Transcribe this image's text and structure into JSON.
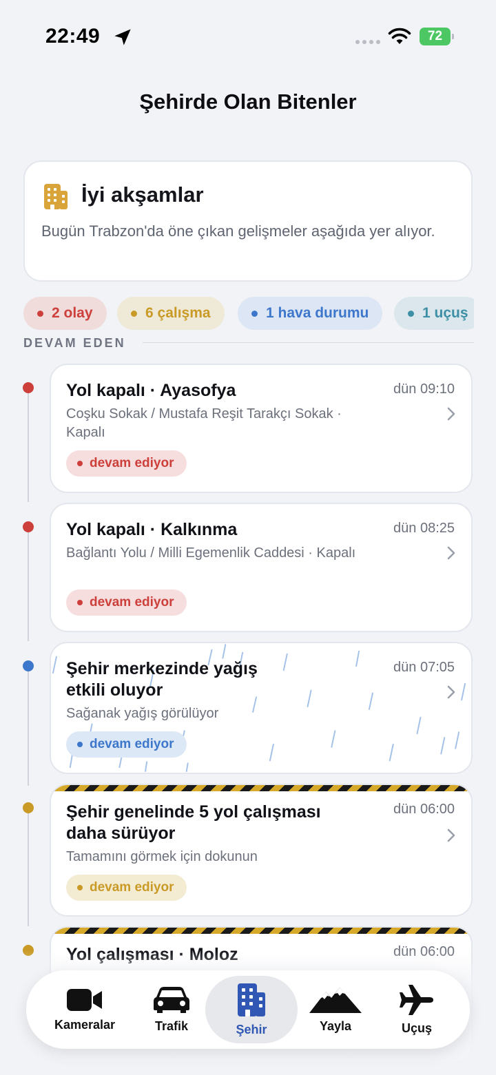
{
  "status_bar": {
    "time": "22:49",
    "battery": "72"
  },
  "page_title": "Şehirde Olan Bitenler",
  "greeting": {
    "title": "İyi akşamlar",
    "text": "Bugün Trabzon'da öne çıkan gelişmeler aşağıda yer alıyor."
  },
  "chips": [
    {
      "label": "2 olay",
      "color": "#cc3f3a"
    },
    {
      "label": "6 çalışma",
      "color": "#c99a26"
    },
    {
      "label": "1 hava durumu",
      "color": "#3d77cc"
    },
    {
      "label": "1 uçuş",
      "color": "#3c8fa5"
    }
  ],
  "section_label": "DEVAM EDEN",
  "events": [
    {
      "title": "Yol kapalı · Ayasofya",
      "time": "dün 09:10",
      "subtitle": "Coşku Sokak / Mustafa Reşit Tarakçı Sokak · Kapalı",
      "status": "devam ediyor",
      "color": "#cc3f3a"
    },
    {
      "title": "Yol kapalı · Kalkınma",
      "time": "dün 08:25",
      "subtitle": "Bağlantı Yolu / Milli Egemenlik Caddesi · Kapalı",
      "status": "devam ediyor",
      "color": "#cc3f3a"
    },
    {
      "title": "Şehir merkezinde yağış etkili oluyor",
      "time": "dün 07:05",
      "subtitle": "Sağanak yağış görülüyor",
      "status": "devam ediyor",
      "color": "#3d77cc"
    },
    {
      "title": "Şehir genelinde 5 yol çalışması daha sürüyor",
      "time": "dün 06:00",
      "subtitle": "Tamamını görmek için dokunun",
      "status": "devam ediyor",
      "color": "#c99a26"
    },
    {
      "title": "Yol çalışması · Moloz",
      "time": "dün 06:00",
      "color": "#c99a26"
    }
  ],
  "tabs": [
    {
      "label": "Kameralar",
      "icon": "video-camera-icon"
    },
    {
      "label": "Trafik",
      "icon": "car-icon"
    },
    {
      "label": "Şehir",
      "icon": "building-icon",
      "active": true
    },
    {
      "label": "Yayla",
      "icon": "mountain-icon"
    },
    {
      "label": "Uçuş",
      "icon": "airplane-icon"
    }
  ]
}
